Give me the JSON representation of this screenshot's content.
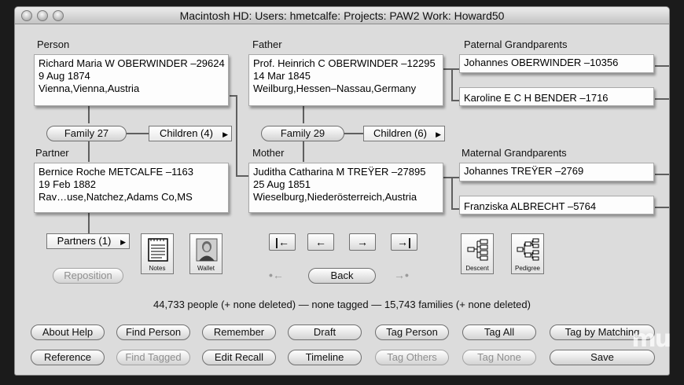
{
  "window": {
    "title": "Macintosh HD: Users: hmetcalfe: Projects: PAW2 Work: Howard50"
  },
  "person": {
    "heading": "Person",
    "name": "Richard Maria W OBERWINDER –29624",
    "date": "9 Aug 1874",
    "place": "Vienna,Vienna,Austria",
    "family_button": "Family 27",
    "children_button": "Children (4)"
  },
  "partner": {
    "heading": "Partner",
    "name": "Bernice Roche METCALFE –1163",
    "date": "19 Feb 1882",
    "place": "Rav…use,Natchez,Adams Co,MS",
    "partners_button": "Partners (1)",
    "reposition_button": "Reposition"
  },
  "father": {
    "heading": "Father",
    "name": "Prof. Heinrich C OBERWINDER –12295",
    "date": "14 Mar 1845",
    "place": "Weilburg,Hessen–Nassau,Germany",
    "family_button": "Family 29",
    "children_button": "Children (6)"
  },
  "mother": {
    "heading": "Mother",
    "name": "Juditha Catharina M TREŸER –27895",
    "date": "25 Aug 1851",
    "place": "Wieselburg,Niederösterreich,Austria"
  },
  "paternal": {
    "heading": "Paternal Grandparents",
    "grandfather": "Johannes OBERWINDER –10356",
    "grandmother": "Karoline E C H BENDER –1716"
  },
  "maternal": {
    "heading": "Maternal Grandparents",
    "grandfather": "Johannes TREŸER –2769",
    "grandmother": "Franziska ALBRECHT –5764"
  },
  "icons": {
    "notes": "Notes",
    "wallet": "Wallet",
    "descent": "Descent",
    "pedigree": "Pedigree"
  },
  "nav": {
    "first": "|←",
    "prev": "←",
    "next": "→",
    "last": "→|",
    "history_back_ghost": "•←",
    "history_fwd_ghost": "→•",
    "back": "Back"
  },
  "stats": "44,733 people (+ none deleted) — none tagged — 15,743 families (+ none deleted)",
  "buttons_row1": [
    "About Help",
    "Find Person",
    "Remember",
    "Draft",
    "Tag Person",
    "Tag All",
    "Tag by Matching"
  ],
  "buttons_row2": [
    "Reference",
    "Find Tagged",
    "Edit Recall",
    "Timeline",
    "Tag Others",
    "Tag None",
    "Save"
  ],
  "watermark": "mu"
}
